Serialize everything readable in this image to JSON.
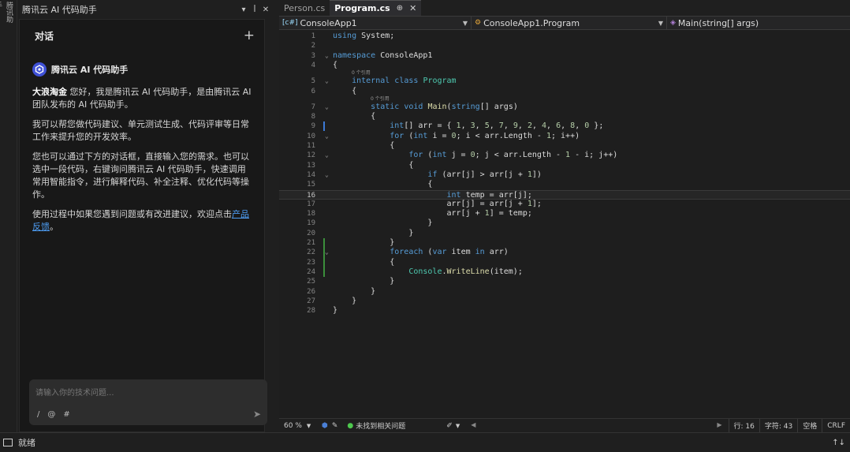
{
  "side_strip": {
    "tab_label": "腾讯助手"
  },
  "chat_panel": {
    "title": "腾讯云 AI 代码助手",
    "header_title": "对话",
    "assistant_name": "腾讯云 AI 代码助手",
    "greeting_bold": "大浪淘金",
    "greeting_rest": " 您好，我是腾讯云 AI 代码助手，是由腾讯云 AI 团队发布的 AI 代码助手。",
    "paragraph_2": "我可以帮您做代码建议、单元测试生成、代码评审等日常工作来提升您的开发效率。",
    "paragraph_3": "您也可以通过下方的对话框，直接输入您的需求。也可以选中一段代码，右键询问腾讯云 AI 代码助手，快速调用常用智能指令，进行解释代码、补全注释、优化代码等操作。",
    "paragraph_4_prefix": "使用过程中如果您遇到问题或有改进建议，欢迎点击",
    "paragraph_4_link": "产品反馈",
    "paragraph_4_suffix": "。",
    "input_placeholder": "请输入你的技术问题...",
    "tool_slash": "/",
    "tool_at": "@",
    "tool_hash": "#"
  },
  "editor": {
    "tabs": [
      {
        "label": "Person.cs",
        "active": false
      },
      {
        "label": "Program.cs",
        "active": true
      }
    ],
    "tab_pin": "⊕",
    "tab_close": "✕",
    "navbar": {
      "project": "ConsoleApp1",
      "class": "ConsoleApp1.Program",
      "member": "Main(string[] args)"
    },
    "reference_label": "0 个引用",
    "current_line": 16,
    "lines": [
      {
        "n": "1",
        "text": "using System;"
      },
      {
        "n": "2",
        "text": ""
      },
      {
        "n": "3",
        "text": "namespace ConsoleApp1"
      },
      {
        "n": "4",
        "text": "{"
      },
      {
        "n": "5",
        "text": "    internal class Program"
      },
      {
        "n": "6",
        "text": "    {"
      },
      {
        "n": "7",
        "text": "        static void Main(string[] args)"
      },
      {
        "n": "8",
        "text": "        {"
      },
      {
        "n": "9",
        "text": "            int[] arr = { 1, 3, 5, 7, 9, 2, 4, 6, 8, 0 };"
      },
      {
        "n": "10",
        "text": "            for (int i = 0; i < arr.Length - 1; i++)"
      },
      {
        "n": "11",
        "text": "            {"
      },
      {
        "n": "12",
        "text": "                for (int j = 0; j < arr.Length - 1 - i; j++)"
      },
      {
        "n": "13",
        "text": "                {"
      },
      {
        "n": "14",
        "text": "                    if (arr[j] > arr[j + 1])"
      },
      {
        "n": "15",
        "text": "                    {"
      },
      {
        "n": "16",
        "text": "                        int temp = arr[j];"
      },
      {
        "n": "17",
        "text": "                        arr[j] = arr[j + 1];"
      },
      {
        "n": "18",
        "text": "                        arr[j + 1] = temp;"
      },
      {
        "n": "19",
        "text": "                    }"
      },
      {
        "n": "20",
        "text": "                }"
      },
      {
        "n": "21",
        "text": "            }"
      },
      {
        "n": "22",
        "text": "            foreach (var item in arr)"
      },
      {
        "n": "23",
        "text": "            {"
      },
      {
        "n": "24",
        "text": "                Console.WriteLine(item);"
      },
      {
        "n": "25",
        "text": "            }"
      },
      {
        "n": "26",
        "text": "        }"
      },
      {
        "n": "27",
        "text": "    }"
      },
      {
        "n": "28",
        "text": "}"
      }
    ],
    "status": {
      "zoom": "60 %",
      "issues": "未找到相关问题",
      "line": "行: 16",
      "char": "字符: 43",
      "mode": "空格",
      "eol": "CRLF"
    }
  },
  "statusbar": {
    "ready": "就绪",
    "arrows": "↑↓"
  },
  "colors": {
    "keyword": "#569cd6",
    "type": "#4ec9b0",
    "number": "#b5cea8",
    "method": "#dcdcaa",
    "link": "#4e9ef5"
  }
}
